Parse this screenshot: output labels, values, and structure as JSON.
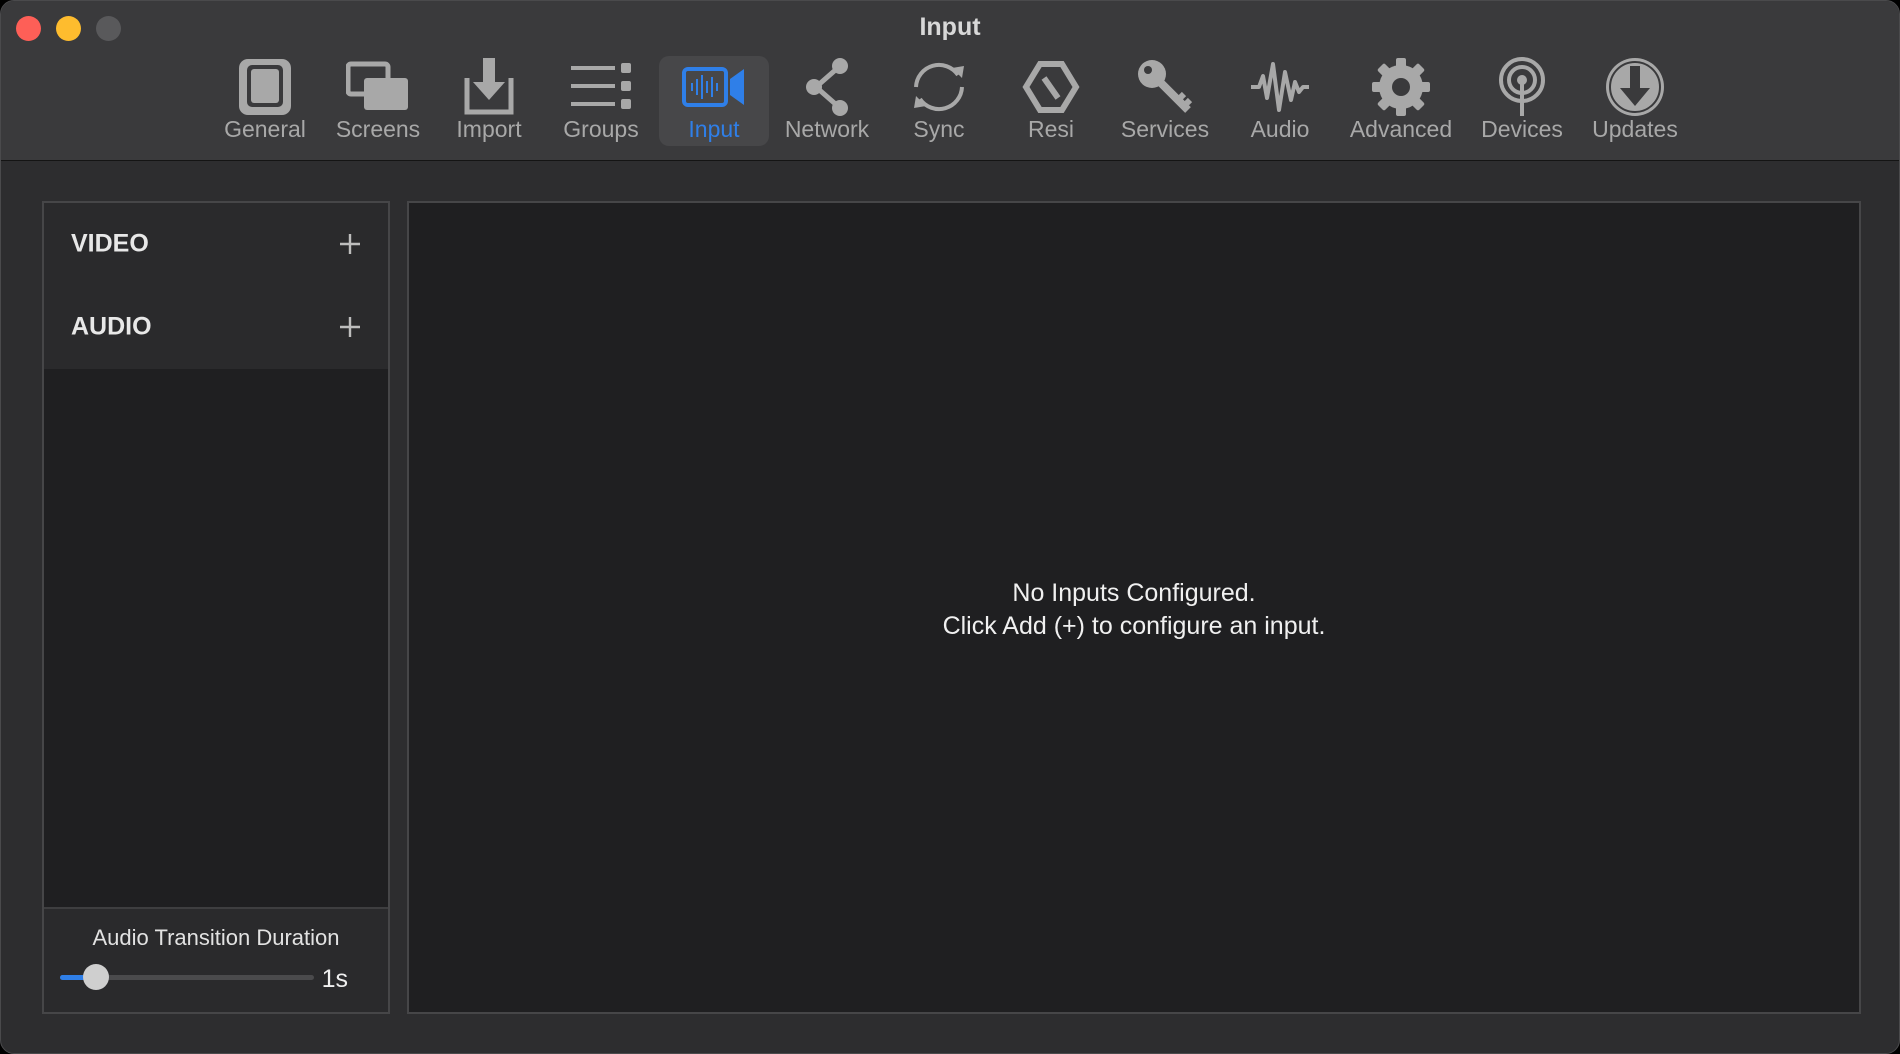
{
  "window": {
    "title": "Input"
  },
  "toolbar": {
    "items": [
      {
        "label": "General",
        "icon": "device-icon"
      },
      {
        "label": "Screens",
        "icon": "screens-icon"
      },
      {
        "label": "Import",
        "icon": "import-icon"
      },
      {
        "label": "Groups",
        "icon": "groups-icon"
      },
      {
        "label": "Input",
        "icon": "video-input-icon",
        "active": true
      },
      {
        "label": "Network",
        "icon": "share-icon"
      },
      {
        "label": "Sync",
        "icon": "sync-icon"
      },
      {
        "label": "Resi",
        "icon": "resi-icon"
      },
      {
        "label": "Services",
        "icon": "key-icon"
      },
      {
        "label": "Audio",
        "icon": "waveform-icon"
      },
      {
        "label": "Advanced",
        "icon": "gear-icon"
      },
      {
        "label": "Devices",
        "icon": "antenna-icon"
      },
      {
        "label": "Updates",
        "icon": "download-icon"
      }
    ]
  },
  "sidebar": {
    "sections": [
      {
        "label": "VIDEO"
      },
      {
        "label": "AUDIO"
      }
    ],
    "audio_transition": {
      "label": "Audio Transition Duration",
      "value_text": "1s",
      "slider_fraction": 0.14
    }
  },
  "main": {
    "empty_line1": "No Inputs Configured.",
    "empty_line2": "Click Add (+) to configure an input."
  },
  "colors": {
    "accent": "#2f7fe8",
    "close": "#fe5f57",
    "minimize": "#febc2e"
  }
}
